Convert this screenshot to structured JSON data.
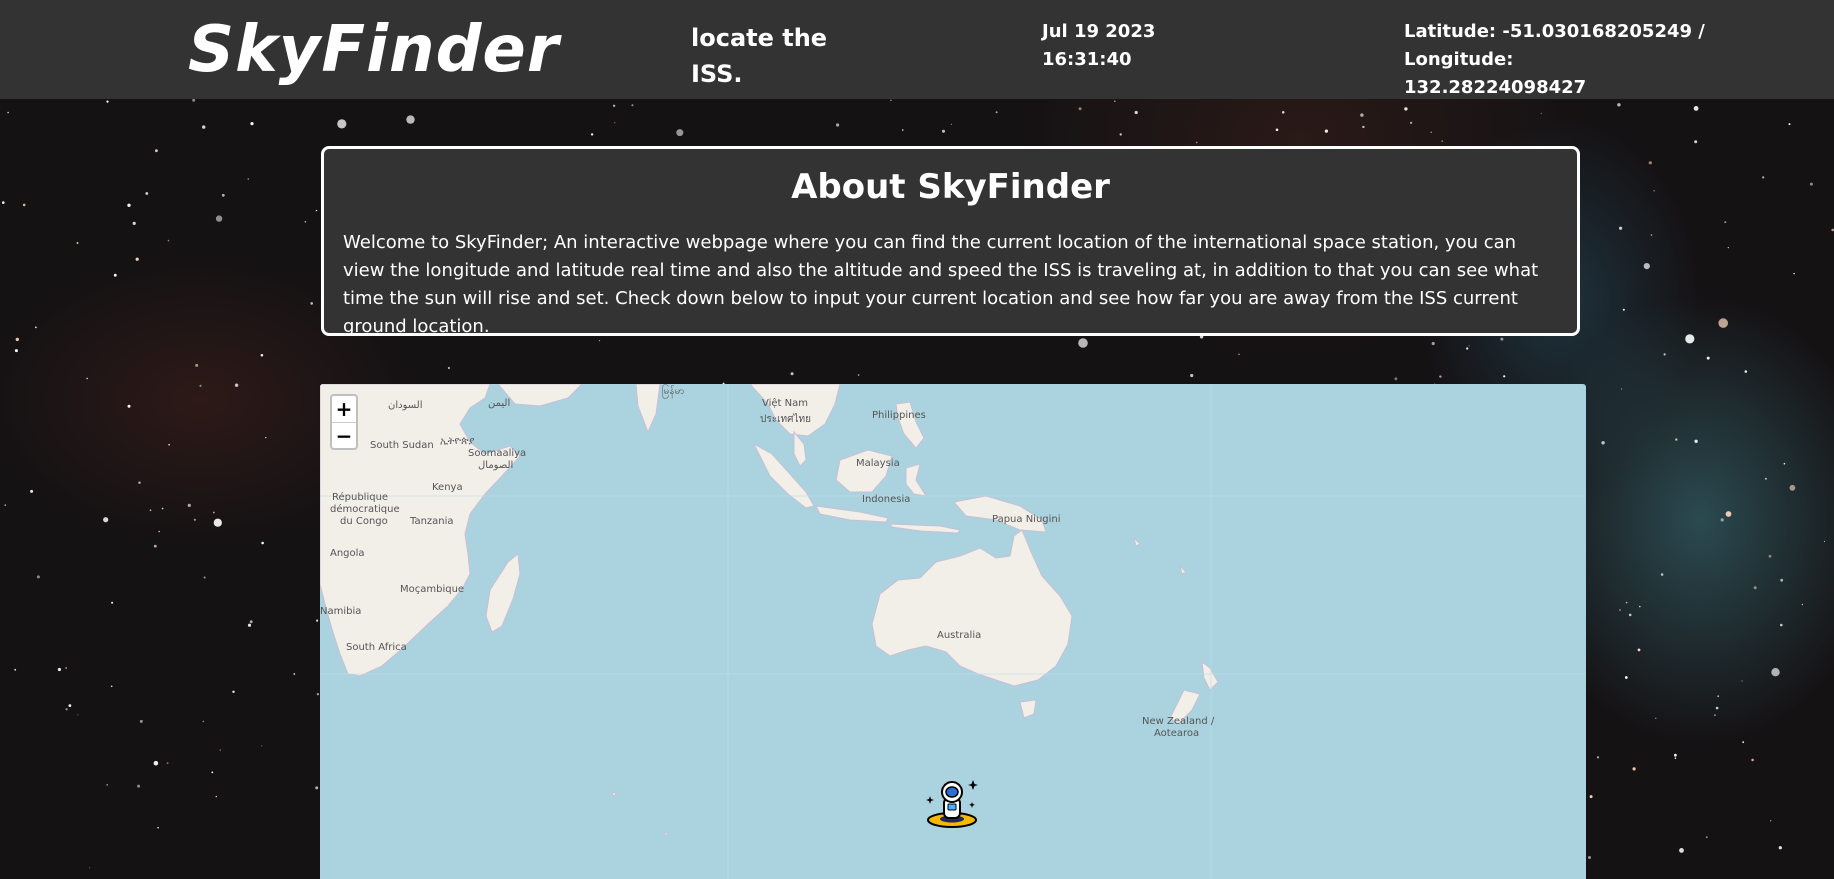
{
  "header": {
    "logo": "SkyFinder",
    "tagline": "locate the ISS.",
    "date": "Jul 19 2023",
    "time": "16:31:40",
    "coords_line1": "Latitude: -51.030168205249 / Longitude:",
    "coords_line2": "132.28224098427"
  },
  "about": {
    "title": "About SkyFinder",
    "body": "Welcome to SkyFinder; An interactive webpage where you can find the current location of the international space station, you can view the longitude and latitude real time and also the altitude and speed the ISS is traveling at, in addition to that you can see what time the sun will rise and set. Check down below to input your current location and see how far you are away from the ISS current ground location."
  },
  "map": {
    "zoom_in": "+",
    "zoom_out": "−",
    "labels": {
      "sudan": "السودان",
      "yemen": "اليمن",
      "south_sudan": "South Sudan",
      "ethiopia": "ኢትዮጵያ",
      "somalia_1": "Soomaaliya",
      "somalia_2": "الصومال",
      "kenya": "Kenya",
      "drc_1": "République",
      "drc_2": "démocratique",
      "drc_3": "du Congo",
      "tanzania": "Tanzania",
      "angola": "Angola",
      "mozambique": "Moçambique",
      "namibia": "Namibia",
      "south_africa": "South Africa",
      "vietnam": "Việt Nam",
      "laos_thai": "ประเทศไทย",
      "myanmar": "မြန်မာ",
      "philippines": "Philippines",
      "malaysia": "Malaysia",
      "indonesia": "Indonesia",
      "png": "Papua Niugini",
      "australia": "Australia",
      "nz_1": "New Zealand /",
      "nz_2": "Aotearoa"
    },
    "marker_icon": "astronaut-icon",
    "colors": {
      "water": "#aad3df",
      "land": "#f2efe9"
    }
  }
}
